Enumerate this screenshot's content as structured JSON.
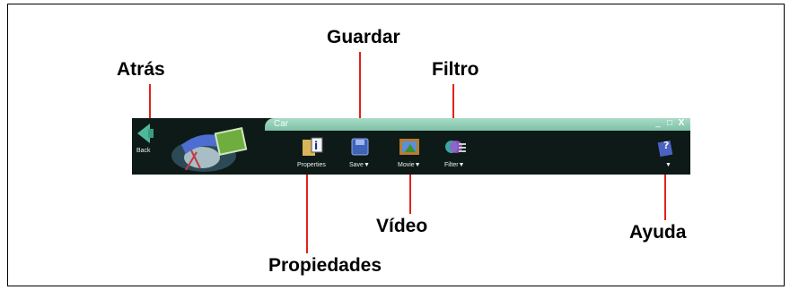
{
  "app": {
    "window_title": "Car",
    "window_controls": [
      "_",
      "□",
      "X"
    ]
  },
  "toolbar": {
    "back_label": "Back",
    "properties_label": "Properties",
    "save_label": "Save▼",
    "movie_label": "Movie▼",
    "filter_label": "Filter▼",
    "help_label": "▼"
  },
  "callouts": {
    "back": "Atrás",
    "save": "Guardar",
    "filter": "Filtro",
    "properties": "Propiedades",
    "video": "Vídeo",
    "help": "Ayuda"
  },
  "colors": {
    "callout_line": "#e0231b",
    "toolbar_bg": "#0d1a17",
    "titlebar": "#8fcfb5"
  },
  "icons": [
    "back-arrow-icon",
    "properties-icon",
    "save-disk-icon",
    "movie-icon",
    "filter-icon",
    "help-icon"
  ]
}
